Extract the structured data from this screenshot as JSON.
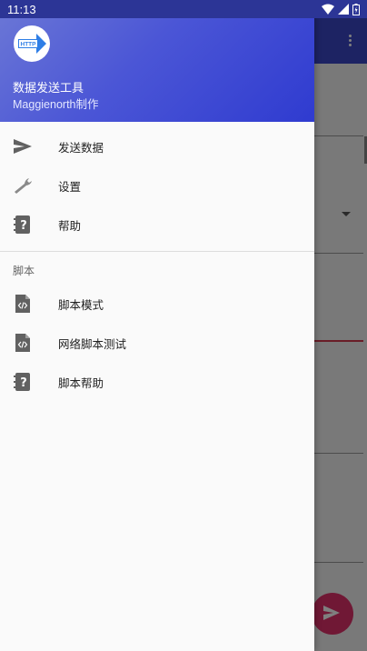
{
  "status_bar": {
    "time": "11:13"
  },
  "drawer": {
    "header": {
      "app_name": "数据发送工具",
      "author": "Maggienorth制作",
      "logo_text": "HTTP"
    },
    "items": [
      {
        "label": "发送数据",
        "icon": "send-icon"
      },
      {
        "label": "设置",
        "icon": "wrench-icon"
      },
      {
        "label": "帮助",
        "icon": "help-notebook-icon"
      }
    ],
    "section_title": "脚本",
    "script_items": [
      {
        "label": "脚本模式",
        "icon": "code-file-icon"
      },
      {
        "label": "网络脚本测试",
        "icon": "code-file-icon"
      },
      {
        "label": "脚本帮助",
        "icon": "help-notebook-icon"
      }
    ]
  },
  "colors": {
    "header_gradient_start": "#6c78d6",
    "header_gradient_end": "#2f3bd0",
    "toolbar": "#3a47c6",
    "fab": "#e0306a",
    "accent_red": "#d23b4f"
  }
}
